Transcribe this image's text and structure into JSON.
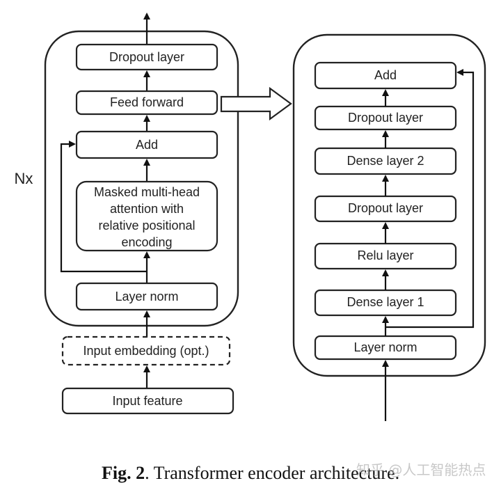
{
  "left_block": {
    "repeat_label": "Nx",
    "dropout": "Dropout layer",
    "feed_forward": "Feed forward",
    "add": "Add",
    "attention": [
      "Masked multi-head",
      "attention with",
      "relative positional",
      "encoding"
    ],
    "layer_norm": "Layer norm"
  },
  "input_embedding": "Input embedding (opt.)",
  "input_feature": "Input feature",
  "right_block": {
    "add": "Add",
    "dropout_2": "Dropout layer",
    "dense_2": "Dense layer 2",
    "dropout_1": "Dropout layer",
    "relu": "Relu layer",
    "dense_1": "Dense layer 1",
    "layer_norm": "Layer norm"
  },
  "caption": {
    "label": "Fig. 2",
    "text": ". Transformer encoder architecture."
  },
  "watermark": "知乎 @人工智能热点"
}
